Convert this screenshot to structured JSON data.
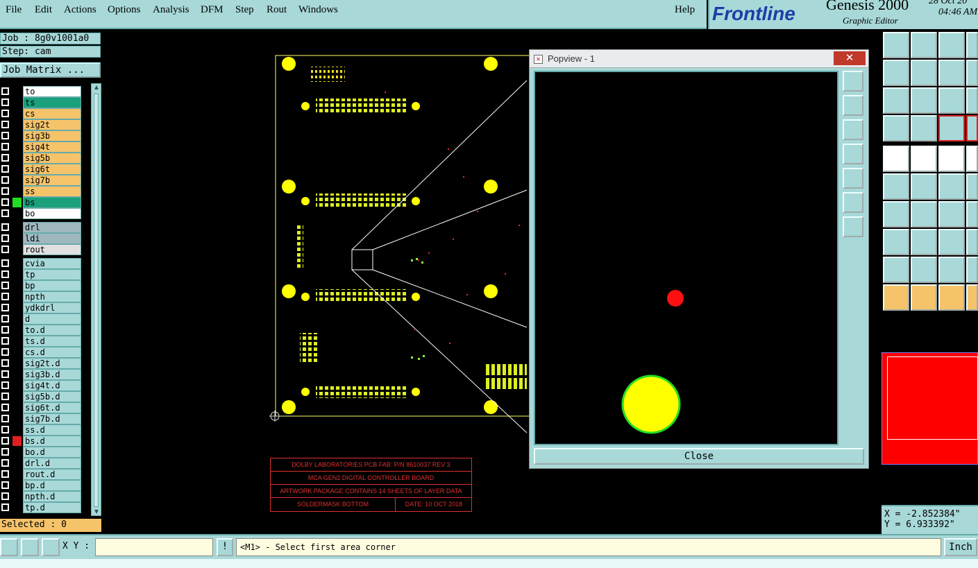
{
  "menu": {
    "items": [
      "File",
      "Edit",
      "Actions",
      "Options",
      "Analysis",
      "DFM",
      "Step",
      "Rout",
      "Windows"
    ],
    "help": "Help"
  },
  "brand": {
    "logo": "Frontline",
    "app": "Genesis 2000",
    "editor": "Graphic Editor",
    "date": "28 Oct 20",
    "time": "04:46 AM"
  },
  "job": {
    "job_label": "Job : 8g0v1001a0",
    "step_label": "Step: cam",
    "matrix_button": "Job Matrix ..."
  },
  "layers": [
    {
      "name": "to",
      "color": "#ffffff",
      "sel": ""
    },
    {
      "name": "ts",
      "color": "#1aa07a",
      "sel": ""
    },
    {
      "name": "cs",
      "color": "#f5c36a",
      "sel": ""
    },
    {
      "name": "sig2t",
      "color": "#f5c36a",
      "sel": ""
    },
    {
      "name": "sig3b",
      "color": "#f5c36a",
      "sel": ""
    },
    {
      "name": "sig4t",
      "color": "#f5c36a",
      "sel": ""
    },
    {
      "name": "sig5b",
      "color": "#f5c36a",
      "sel": ""
    },
    {
      "name": "sig6t",
      "color": "#f5c36a",
      "sel": ""
    },
    {
      "name": "sig7b",
      "color": "#f5c36a",
      "sel": ""
    },
    {
      "name": "ss",
      "color": "#f5c36a",
      "sel": ""
    },
    {
      "name": "bs",
      "color": "#1aa07a",
      "sel": "#22dd22"
    },
    {
      "name": "bo",
      "color": "#ffffff",
      "sel": ""
    },
    {
      "name": "drl",
      "color": "#9fb8c0",
      "sel": ""
    },
    {
      "name": "ldi",
      "color": "#9fb8c0",
      "sel": ""
    },
    {
      "name": "rout",
      "color": "#e0e0e0",
      "sel": ""
    },
    {
      "name": "cvia",
      "color": "#a8d8d8",
      "sel": ""
    },
    {
      "name": "tp",
      "color": "#a8d8d8",
      "sel": ""
    },
    {
      "name": "bp",
      "color": "#a8d8d8",
      "sel": ""
    },
    {
      "name": "npth",
      "color": "#a8d8d8",
      "sel": ""
    },
    {
      "name": "ydkdrl",
      "color": "#a8d8d8",
      "sel": ""
    },
    {
      "name": "d",
      "color": "#a8d8d8",
      "sel": ""
    },
    {
      "name": "to.d",
      "color": "#a8d8d8",
      "sel": ""
    },
    {
      "name": "ts.d",
      "color": "#a8d8d8",
      "sel": ""
    },
    {
      "name": "cs.d",
      "color": "#a8d8d8",
      "sel": ""
    },
    {
      "name": "sig2t.d",
      "color": "#a8d8d8",
      "sel": ""
    },
    {
      "name": "sig3b.d",
      "color": "#a8d8d8",
      "sel": ""
    },
    {
      "name": "sig4t.d",
      "color": "#a8d8d8",
      "sel": ""
    },
    {
      "name": "sig5b.d",
      "color": "#a8d8d8",
      "sel": ""
    },
    {
      "name": "sig6t.d",
      "color": "#a8d8d8",
      "sel": ""
    },
    {
      "name": "sig7b.d",
      "color": "#a8d8d8",
      "sel": ""
    },
    {
      "name": "ss.d",
      "color": "#a8d8d8",
      "sel": ""
    },
    {
      "name": "bs.d",
      "color": "#a8d8d8",
      "sel": "#e02020"
    },
    {
      "name": "bo.d",
      "color": "#a8d8d8",
      "sel": ""
    },
    {
      "name": "drl.d",
      "color": "#a8d8d8",
      "sel": ""
    },
    {
      "name": "rout.d",
      "color": "#a8d8d8",
      "sel": ""
    },
    {
      "name": "bp.d",
      "color": "#a8d8d8",
      "sel": ""
    },
    {
      "name": "npth.d",
      "color": "#a8d8d8",
      "sel": ""
    },
    {
      "name": "tp.d",
      "color": "#a8d8d8",
      "sel": ""
    }
  ],
  "selected": "Selected : 0",
  "title_block": {
    "line1": "DOLBY LABORATORIES PCB FAB: P/N 8610037 REV 3",
    "line2": "MCA GEN2 DIGITAL CONTROLLER BOARD",
    "line3": "ARTWORK PACKAGE CONTAINS 14 SHEETS OF LAYER DATA",
    "line4a": "SOLDERMASK BOTTOM",
    "line4b": "DATE: 10 OCT 2018"
  },
  "popview": {
    "title": "Popview - 1",
    "close_x": "✕",
    "close_button": "Close"
  },
  "coords": {
    "x": "X = -2.852384\"",
    "y": "Y = 6.933392\""
  },
  "bottom": {
    "xy_label": "X Y :",
    "xy_value": "",
    "message": "<M1> - Select first area corner",
    "units": "Inch"
  },
  "colors": {
    "panel": "#a8d8d8",
    "pad_yellow": "#ffff00",
    "pad_red": "#ff1010",
    "outline_green": "#22dd22"
  }
}
